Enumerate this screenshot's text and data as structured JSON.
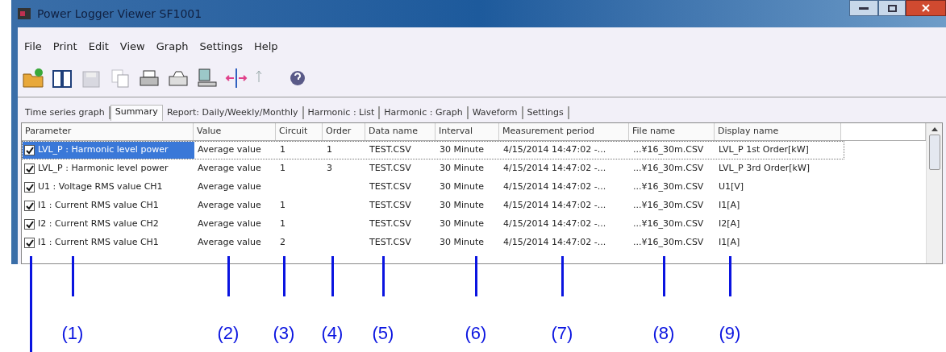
{
  "window": {
    "title": "Power Logger Viewer SF1001"
  },
  "menu": [
    "File",
    "Print",
    "Edit",
    "View",
    "Graph",
    "Settings",
    "Help"
  ],
  "tabs": [
    {
      "label": "Time series graph",
      "selected": false
    },
    {
      "label": "Summary",
      "selected": true
    },
    {
      "label": "Report: Daily/Weekly/Monthly",
      "selected": false
    },
    {
      "label": "Harmonic : List",
      "selected": false
    },
    {
      "label": "Harmonic : Graph",
      "selected": false
    },
    {
      "label": "Waveform",
      "selected": false
    },
    {
      "label": "Settings",
      "selected": false
    }
  ],
  "table": {
    "columns": [
      "Parameter",
      "Value",
      "Circuit",
      "Order",
      "Data name",
      "Interval",
      "Measurement period",
      "File name",
      "Display name"
    ],
    "rows": [
      {
        "selected": true,
        "checked": true,
        "cells": [
          "LVL_P : Harmonic level power",
          "Average value",
          "1",
          "1",
          "TEST.CSV",
          "30 Minute",
          "4/15/2014 14:47:02 -...",
          "...¥16_30m.CSV",
          "LVL_P 1st Order[kW]"
        ]
      },
      {
        "selected": false,
        "checked": true,
        "cells": [
          "LVL_P : Harmonic level power",
          "Average value",
          "1",
          "3",
          "TEST.CSV",
          "30 Minute",
          "4/15/2014 14:47:02 -...",
          "...¥16_30m.CSV",
          "LVL_P 3rd Order[kW]"
        ]
      },
      {
        "selected": false,
        "checked": true,
        "cells": [
          "U1 : Voltage RMS value CH1",
          "Average value",
          "",
          "",
          "TEST.CSV",
          "30 Minute",
          "4/15/2014 14:47:02 -...",
          "...¥16_30m.CSV",
          "U1[V]"
        ]
      },
      {
        "selected": false,
        "checked": true,
        "cells": [
          "I1 : Current RMS value CH1",
          "Average value",
          "1",
          "",
          "TEST.CSV",
          "30 Minute",
          "4/15/2014 14:47:02 -...",
          "...¥16_30m.CSV",
          "I1[A]"
        ]
      },
      {
        "selected": false,
        "checked": true,
        "cells": [
          "I2 : Current RMS value CH2",
          "Average value",
          "1",
          "",
          "TEST.CSV",
          "30 Minute",
          "4/15/2014 14:47:02 -...",
          "...¥16_30m.CSV",
          "I2[A]"
        ]
      },
      {
        "selected": false,
        "checked": true,
        "cells": [
          "I1 : Current RMS value CH1",
          "Average value",
          "2",
          "",
          "TEST.CSV",
          "30 Minute",
          "4/15/2014 14:47:02 -...",
          "...¥16_30m.CSV",
          "I1[A]"
        ]
      }
    ]
  },
  "callouts": [
    "(1)",
    "(2)",
    "(3)",
    "(4)",
    "(5)",
    "(6)",
    "(7)",
    "(8)",
    "(9)"
  ]
}
